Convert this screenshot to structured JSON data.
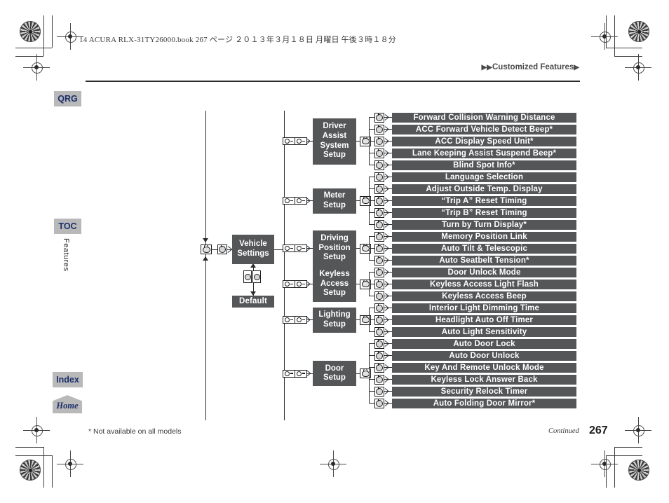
{
  "page": {
    "book_line": "14 ACURA RLX-31TY26000.book   267 ページ   ２０１３年３月１８日   月曜日   午後３時１８分",
    "running_head": "Customized Features",
    "running_head_prefix": "▶▶",
    "running_head_suffix": "▶",
    "footnote": "* Not available on all models",
    "continued": "Continued",
    "page_number": "267"
  },
  "sidebar": {
    "items": [
      {
        "label": "QRG",
        "name": "qrg"
      },
      {
        "label": "TOC",
        "name": "toc"
      },
      {
        "label": "Index",
        "name": "index"
      },
      {
        "label": "Home",
        "name": "home"
      }
    ],
    "section_label": "Features"
  },
  "diagram": {
    "root": {
      "label": "Vehicle Settings",
      "line1": "Vehicle",
      "line2": "Settings"
    },
    "default": {
      "label": "Default"
    },
    "icons": {
      "phone": "phone-button-icon",
      "knob": "selector-knob-icon",
      "enter": "enter-button-icon",
      "arrow": "arrow-icon"
    },
    "groups": [
      {
        "name": "driver-assist-system-setup",
        "lines": [
          "Driver",
          "Assist",
          "System",
          "Setup"
        ],
        "label": "Driver Assist System Setup",
        "items": [
          "Forward Collision Warning Distance",
          "ACC Forward Vehicle Detect Beep*",
          "ACC Display Speed Unit*",
          "Lane Keeping Assist Suspend Beep*",
          "Blind Spot Info*"
        ]
      },
      {
        "name": "meter-setup",
        "lines": [
          "Meter",
          "Setup"
        ],
        "label": "Meter Setup",
        "items": [
          "Language Selection",
          "Adjust Outside Temp. Display",
          "“Trip A” Reset Timing",
          "“Trip B” Reset Timing",
          "Turn by Turn Display*"
        ]
      },
      {
        "name": "driving-position-setup",
        "lines": [
          "Driving",
          "Position",
          "Setup"
        ],
        "label": "Driving Position Setup",
        "items": [
          "Memory Position Link",
          "Auto Tilt & Telescopic",
          "Auto Seatbelt Tension*"
        ]
      },
      {
        "name": "keyless-access-setup",
        "lines": [
          "Keyless",
          "Access",
          "Setup"
        ],
        "label": "Keyless Access Setup",
        "items": [
          "Door Unlock Mode",
          "Keyless Access Light Flash",
          "Keyless Access Beep"
        ]
      },
      {
        "name": "lighting-setup",
        "lines": [
          "Lighting",
          "Setup"
        ],
        "label": "Lighting Setup",
        "items": [
          "Interior Light Dimming Time",
          "Headlight Auto Off Timer",
          "Auto Light Sensitivity"
        ]
      },
      {
        "name": "door-setup",
        "lines": [
          "Door",
          "Setup"
        ],
        "label": "Door Setup",
        "items": [
          "Auto Door Lock",
          "Auto Door Unlock",
          "Key And Remote Unlock Mode",
          "Keyless Lock Answer Back",
          "Security Relock Timer",
          "Auto Folding Door Mirror*"
        ]
      }
    ]
  },
  "colors": {
    "bar_fill": "#555658",
    "bar_text": "#ffffff",
    "tab_fill": "#b9b9b9",
    "tab_text": "#1b2f6b",
    "rule": "#2b2b2b"
  }
}
